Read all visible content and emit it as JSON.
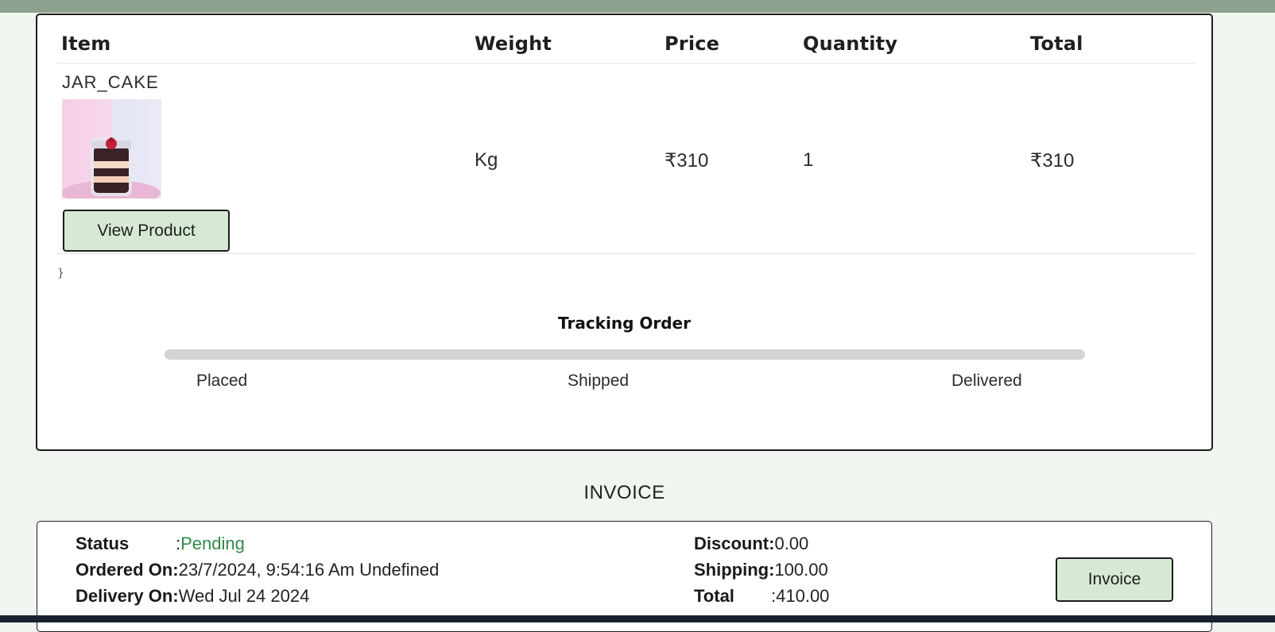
{
  "table": {
    "headers": {
      "item": "Item",
      "weight": "Weight",
      "price": "Price",
      "quantity": "Quantity",
      "total": "Total"
    },
    "rows": [
      {
        "name": "JAR_CAKE",
        "weight": "Kg",
        "price": "₹310",
        "quantity": "1",
        "total": "₹310",
        "view_label": "View Product",
        "image_icon": "jar-cake-image"
      }
    ]
  },
  "stray_text": "}",
  "tracking": {
    "title": "Tracking Order",
    "progress": 0,
    "steps": [
      "Placed",
      "Shipped",
      "Delivered"
    ]
  },
  "invoice": {
    "heading": "INVOICE",
    "status_label": "Status",
    "status_sep": ":",
    "status_value": "Pending",
    "ordered_label": "Ordered On:",
    "ordered_value": "23/7/2024, 9:54:16 Am Undefined",
    "delivery_label": "Delivery On:",
    "delivery_value": "Wed Jul 24 2024",
    "discount_label": "Discount:",
    "discount_value": "0.00",
    "shipping_label": "Shipping:",
    "shipping_value": "100.00",
    "total_label": "Total",
    "total_sep": ":",
    "total_value": "410.00",
    "button_label": "Invoice"
  },
  "colors": {
    "accent_green": "#d7e9d5",
    "status_green": "#2f8a4a",
    "page_bg": "#f0f6ef",
    "topbar": "#8ca18f"
  }
}
